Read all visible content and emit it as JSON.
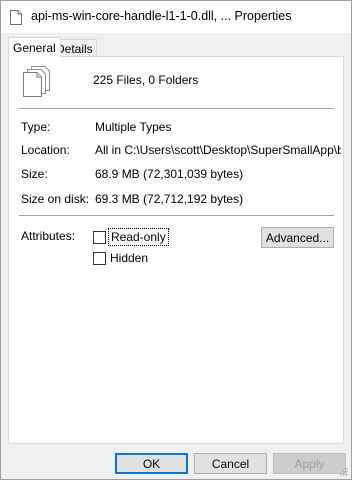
{
  "window": {
    "title": "api-ms-win-core-handle-l1-1-0.dll, ... Properties"
  },
  "tabs": [
    {
      "label": "General",
      "active": true
    },
    {
      "label": "Details",
      "active": false
    }
  ],
  "general": {
    "summary": "225 Files, 0 Folders",
    "rows": {
      "type": {
        "label": "Type:",
        "value": "Multiple Types"
      },
      "location": {
        "label": "Location:",
        "value": "All in C:\\Users\\scott\\Desktop\\SuperSmallApp\\bin\\re"
      },
      "size": {
        "label": "Size:",
        "value": "68.9 MB (72,301,039 bytes)"
      },
      "size_on_disk": {
        "label": "Size on disk:",
        "value": "69.3 MB (72,712,192 bytes)"
      }
    },
    "attributes": {
      "label": "Attributes:",
      "read_only": {
        "label": "Read-only",
        "checked": false
      },
      "hidden": {
        "label": "Hidden",
        "checked": false
      },
      "advanced_button": "Advanced..."
    }
  },
  "buttons": {
    "ok": "OK",
    "cancel": "Cancel",
    "apply": "Apply"
  },
  "colors": {
    "accent": "#0078d7",
    "panel_bg": "#ffffff",
    "window_bg": "#f0f0f0"
  },
  "icons": {
    "title": "document-icon",
    "files": "multiple-files-icon"
  }
}
